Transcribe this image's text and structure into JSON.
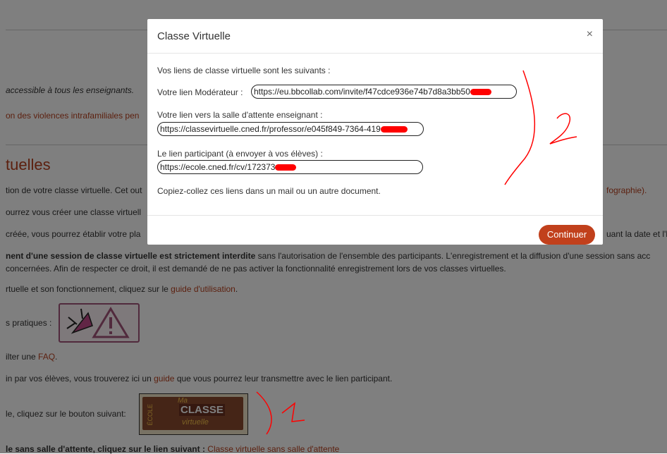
{
  "background": {
    "line1": "accessible à tous les enseignants.",
    "line2": "on des violences intrafamiliales pen",
    "heading": "tuelles",
    "p1a": "tion de votre classe virtuelle. Cet out",
    "p1b": "fographie).",
    "p2": "ourrez vous créer une classe virtuell",
    "p3a": "créée, vous pourrez établir votre pla",
    "p3b": "uant la date et l'h",
    "p4a": "nent d'une session de classe virtuelle est strictement interdite",
    "p4b": "sans l'autorisation de l'ensemble des participants. L'enregistrement et la diffusion d'une session sans acc",
    "p5": "concernées. Afin de respecter ce droit, il est demandé de ne pas activer la fonctionnalité enregistrement lors de vos classes virtuelles.",
    "p6a": "rtuelle et son fonctionnement, cliquez sur le ",
    "p6link": "guide d'utilisation",
    "p6b": ".",
    "pratiques": "s pratiques :",
    "faq_a": "ilter une ",
    "faq_link": "FAQ",
    "faq_b": ".",
    "guide_a": "in par vos élèves, vous trouverez ici un ",
    "guide_link": "guide",
    "guide_b": " que vous pourrez leur transmettre avec le lien participant.",
    "bouton": "le, cliquez sur le bouton suivant:",
    "last_a": "le sans salle d'attente, cliquez sur le lien suivant : ",
    "last_link": "Classe virtuelle sans salle d'attente",
    "badge_top": "Ma",
    "badge_main": "CLASSE",
    "badge_sub": "virtuelle",
    "badge_side": "ÉCOLE"
  },
  "modal": {
    "title": "Classe Virtuelle",
    "close": "×",
    "intro": "Vos liens de classe virtuelle sont les suivants :",
    "moderator_label": "Votre lien Modérateur :",
    "moderator_link": "https://eu.bbcollab.com/invite/f47cdce936e74b7d8a3bb50",
    "waiting_label": "Votre lien vers la salle d'attente enseignant :",
    "waiting_link": "https://classevirtuelle.cned.fr/professor/e045f849-7364-419",
    "participant_label": "Le lien participant (à envoyer à vos élèves) :",
    "participant_link": "https://ecole.cned.fr/cv/172373",
    "footer_note": "Copiez-collez ces liens dans un mail ou un autre document.",
    "continue": "Continuer"
  },
  "colors": {
    "accent": "#c1401c",
    "link": "#b8411f",
    "annotation": "#ff0000"
  }
}
